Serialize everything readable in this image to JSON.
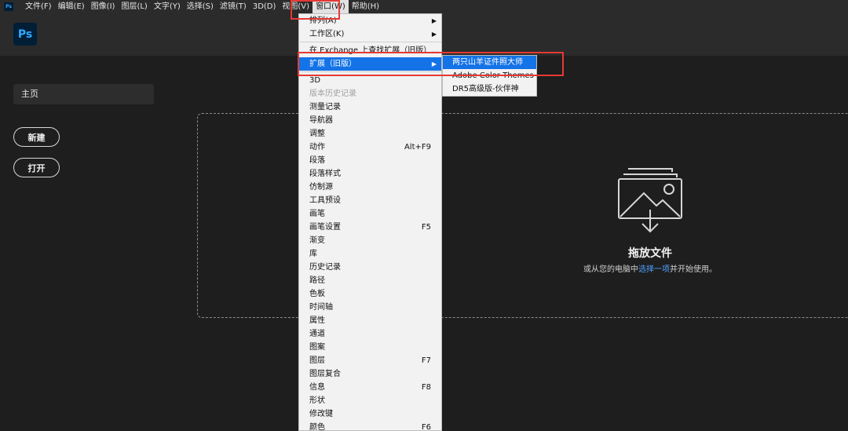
{
  "menubar": {
    "app_icon": "Ps",
    "items": [
      "文件(F)",
      "编辑(E)",
      "图像(I)",
      "图层(L)",
      "文字(Y)",
      "选择(S)",
      "滤镜(T)",
      "3D(D)",
      "视图(V)",
      "窗口(W)",
      "帮助(H)"
    ],
    "active_index": 9
  },
  "header": {
    "logo": "Ps"
  },
  "sidebar": {
    "home_label": "主页",
    "new_label": "新建",
    "open_label": "打开"
  },
  "dropzone": {
    "icon": "image-import-icon",
    "title": "拖放文件",
    "subtitle_before": "或从您的电脑中",
    "subtitle_link": "选择一项",
    "subtitle_after": "并开始使用。"
  },
  "window_menu": {
    "items": [
      {
        "label": "排列(A)",
        "shortcut": "",
        "submenu": true,
        "disabled": false
      },
      {
        "label": "工作区(K)",
        "shortcut": "",
        "submenu": true,
        "disabled": false
      },
      {
        "label": "在 Exchange 上查找扩展（旧版）...",
        "shortcut": "",
        "submenu": false,
        "disabled": false
      },
      {
        "label": "扩展（旧版）",
        "shortcut": "",
        "submenu": true,
        "disabled": false,
        "highlighted": true
      },
      {
        "label": "3D",
        "shortcut": "",
        "submenu": false,
        "disabled": false
      },
      {
        "label": "版本历史记录",
        "shortcut": "",
        "submenu": false,
        "disabled": true
      },
      {
        "label": "测量记录",
        "shortcut": "",
        "submenu": false,
        "disabled": false
      },
      {
        "label": "导航器",
        "shortcut": "",
        "submenu": false,
        "disabled": false
      },
      {
        "label": "调整",
        "shortcut": "",
        "submenu": false,
        "disabled": false
      },
      {
        "label": "动作",
        "shortcut": "Alt+F9",
        "submenu": false,
        "disabled": false
      },
      {
        "label": "段落",
        "shortcut": "",
        "submenu": false,
        "disabled": false
      },
      {
        "label": "段落样式",
        "shortcut": "",
        "submenu": false,
        "disabled": false
      },
      {
        "label": "仿制源",
        "shortcut": "",
        "submenu": false,
        "disabled": false
      },
      {
        "label": "工具预设",
        "shortcut": "",
        "submenu": false,
        "disabled": false
      },
      {
        "label": "画笔",
        "shortcut": "",
        "submenu": false,
        "disabled": false
      },
      {
        "label": "画笔设置",
        "shortcut": "F5",
        "submenu": false,
        "disabled": false
      },
      {
        "label": "渐变",
        "shortcut": "",
        "submenu": false,
        "disabled": false
      },
      {
        "label": "库",
        "shortcut": "",
        "submenu": false,
        "disabled": false
      },
      {
        "label": "历史记录",
        "shortcut": "",
        "submenu": false,
        "disabled": false
      },
      {
        "label": "路径",
        "shortcut": "",
        "submenu": false,
        "disabled": false
      },
      {
        "label": "色板",
        "shortcut": "",
        "submenu": false,
        "disabled": false
      },
      {
        "label": "时间轴",
        "shortcut": "",
        "submenu": false,
        "disabled": false
      },
      {
        "label": "属性",
        "shortcut": "",
        "submenu": false,
        "disabled": false
      },
      {
        "label": "通道",
        "shortcut": "",
        "submenu": false,
        "disabled": false
      },
      {
        "label": "图案",
        "shortcut": "",
        "submenu": false,
        "disabled": false
      },
      {
        "label": "图层",
        "shortcut": "F7",
        "submenu": false,
        "disabled": false
      },
      {
        "label": "图层复合",
        "shortcut": "",
        "submenu": false,
        "disabled": false
      },
      {
        "label": "信息",
        "shortcut": "F8",
        "submenu": false,
        "disabled": false
      },
      {
        "label": "形状",
        "shortcut": "",
        "submenu": false,
        "disabled": false
      },
      {
        "label": "修改键",
        "shortcut": "",
        "submenu": false,
        "disabled": false
      },
      {
        "label": "颜色",
        "shortcut": "F6",
        "submenu": false,
        "disabled": false
      }
    ]
  },
  "extensions_submenu": {
    "items": [
      {
        "label": "两只山羊证件照大师",
        "highlighted": true
      },
      {
        "label": "Adobe Color Themes",
        "highlighted": false
      },
      {
        "label": "DR5高级版-伙伴神",
        "highlighted": false
      }
    ]
  },
  "colors": {
    "accent": "#1473e6",
    "annotation": "#e53935",
    "ps_brand": "#31a8ff",
    "link": "#4ea1ff"
  }
}
